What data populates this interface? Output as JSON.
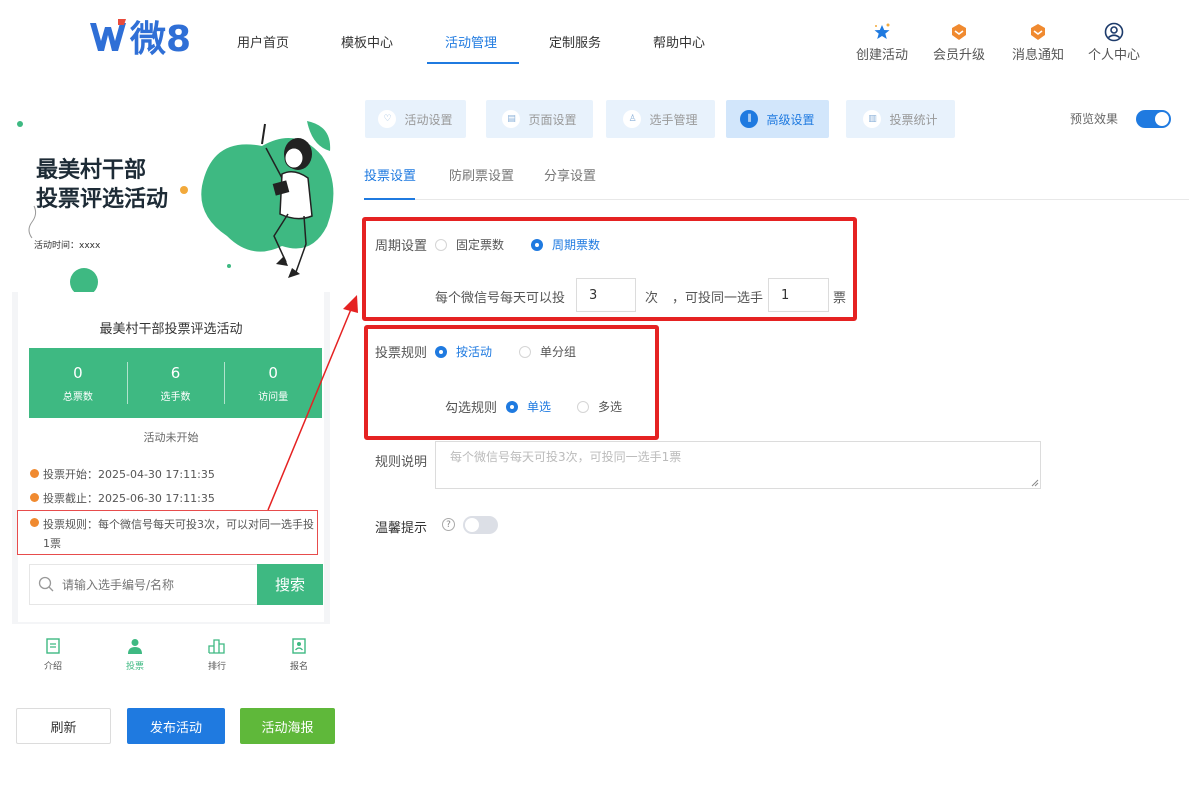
{
  "header": {
    "logo_text": "微8",
    "nav": [
      "用户首页",
      "模板中心",
      "活动管理",
      "定制服务",
      "帮助中心"
    ],
    "active_nav": "活动管理",
    "tools": [
      {
        "icon": "sparkle-star-icon",
        "label": "创建活动"
      },
      {
        "icon": "crown-badge-icon",
        "label": "会员升级"
      },
      {
        "icon": "notification-badge-icon",
        "label": "消息通知"
      },
      {
        "icon": "user-circle-icon",
        "label": "个人中心"
      }
    ]
  },
  "preview": {
    "banner_title_line1": "最美村干部",
    "banner_title_line2": "投票评选活动",
    "banner_time": "活动时间：xxxx",
    "activity_title": "最美村干部投票评选活动",
    "stats": [
      {
        "value": "0",
        "label": "总票数"
      },
      {
        "value": "6",
        "label": "选手数"
      },
      {
        "value": "0",
        "label": "访问量"
      }
    ],
    "status": "活动未开始",
    "vote_start": "投票开始：2025-04-30 17:11:35",
    "vote_end": "投票截止：2025-06-30 17:11:35",
    "vote_rule": "投票规则：每个微信号每天可投3次，可以对同一选手投1票",
    "search_placeholder": "请输入选手编号/名称",
    "search_button": "搜索",
    "tabbar": [
      {
        "icon": "intro-doc-icon",
        "label": "介绍"
      },
      {
        "icon": "person-icon",
        "label": "投票"
      },
      {
        "icon": "ranking-icon",
        "label": "排行"
      },
      {
        "icon": "signup-icon",
        "label": "报名"
      }
    ],
    "active_tab": "投票"
  },
  "actions": {
    "refresh": "刷新",
    "publish": "发布活动",
    "poster": "活动海报"
  },
  "settings": {
    "tabs": [
      "活动设置",
      "页面设置",
      "选手管理",
      "高级设置",
      "投票统计"
    ],
    "active_tab": "高级设置",
    "preview_label": "预览效果",
    "preview_on": true,
    "subtabs": [
      "投票设置",
      "防刷票设置",
      "分享设置"
    ],
    "active_subtab": "投票设置",
    "cycle_label": "周期设置",
    "cycle_options": [
      "固定票数",
      "周期票数"
    ],
    "cycle_selected": "周期票数",
    "per_day_text": "每个微信号每天可以投",
    "per_day_value": "3",
    "times_unit": "次",
    "same_player_text": "，可投同一选手",
    "same_player_value": "1",
    "votes_unit": "票",
    "rule_label": "投票规则",
    "rule_options": [
      "按活动",
      "单分组"
    ],
    "rule_selected": "按活动",
    "check_label": "勾选规则",
    "check_options": [
      "单选",
      "多选"
    ],
    "check_selected": "单选",
    "desc_label": "规则说明",
    "desc_placeholder": "每个微信号每天可投3次，可投同一选手1票",
    "tip_label": "温馨提示",
    "tip_on": false
  },
  "colors": {
    "primary": "#1f7ae0",
    "green": "#3eb982",
    "red_highlight": "#e52222"
  }
}
